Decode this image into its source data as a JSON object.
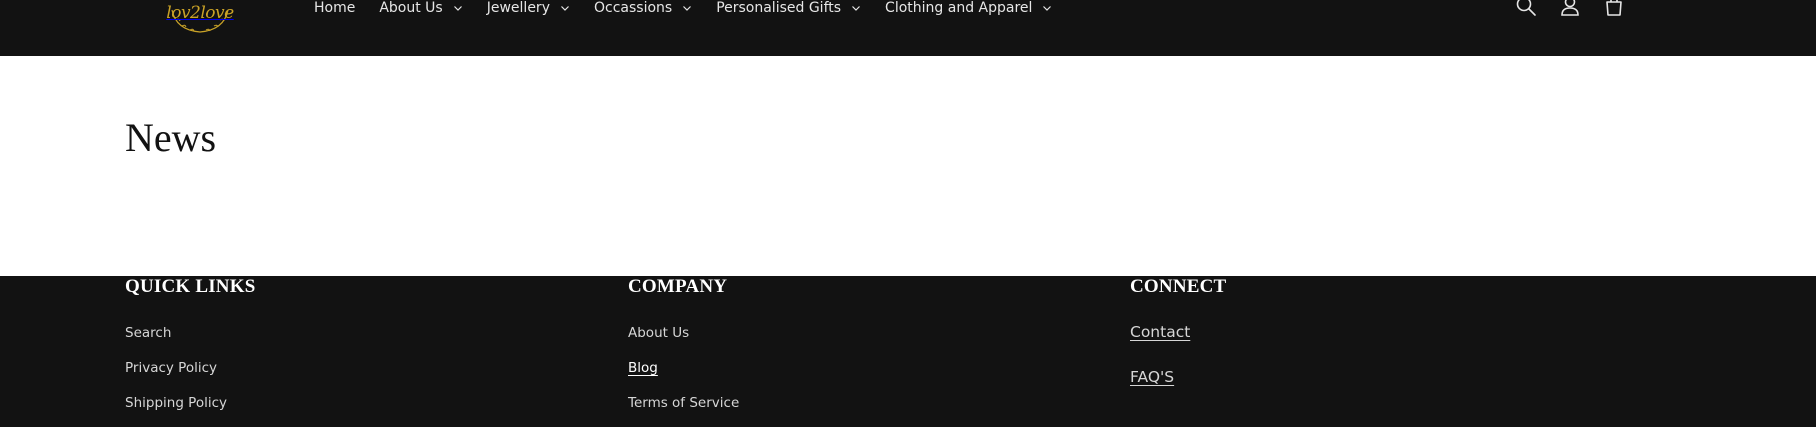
{
  "brand": {
    "logo_text": "lov2love",
    "logo_color": "#c9a227"
  },
  "nav": {
    "items": [
      {
        "label": "Home",
        "has_dropdown": false
      },
      {
        "label": "About Us",
        "has_dropdown": true
      },
      {
        "label": "Jewellery",
        "has_dropdown": true
      },
      {
        "label": "Occassions",
        "has_dropdown": true
      },
      {
        "label": "Personalised Gifts",
        "has_dropdown": true
      },
      {
        "label": "Clothing and Apparel",
        "has_dropdown": true
      }
    ]
  },
  "header_icons": [
    "search-icon",
    "account-icon",
    "cart-icon"
  ],
  "main": {
    "title": "News"
  },
  "footer": {
    "quick_links": {
      "heading": "QUICK LINKS",
      "links": [
        "Search",
        "Privacy Policy",
        "Shipping Policy"
      ]
    },
    "company": {
      "heading": "COMPANY",
      "links": [
        "About Us",
        "Blog",
        "Terms of Service"
      ],
      "active": "Blog"
    },
    "connect": {
      "heading": "CONNECT",
      "links": [
        "Contact",
        "FAQ'S"
      ]
    }
  },
  "colors": {
    "header_bg": "#121212",
    "main_bg": "#ffffff",
    "footer_bg": "#121212"
  }
}
